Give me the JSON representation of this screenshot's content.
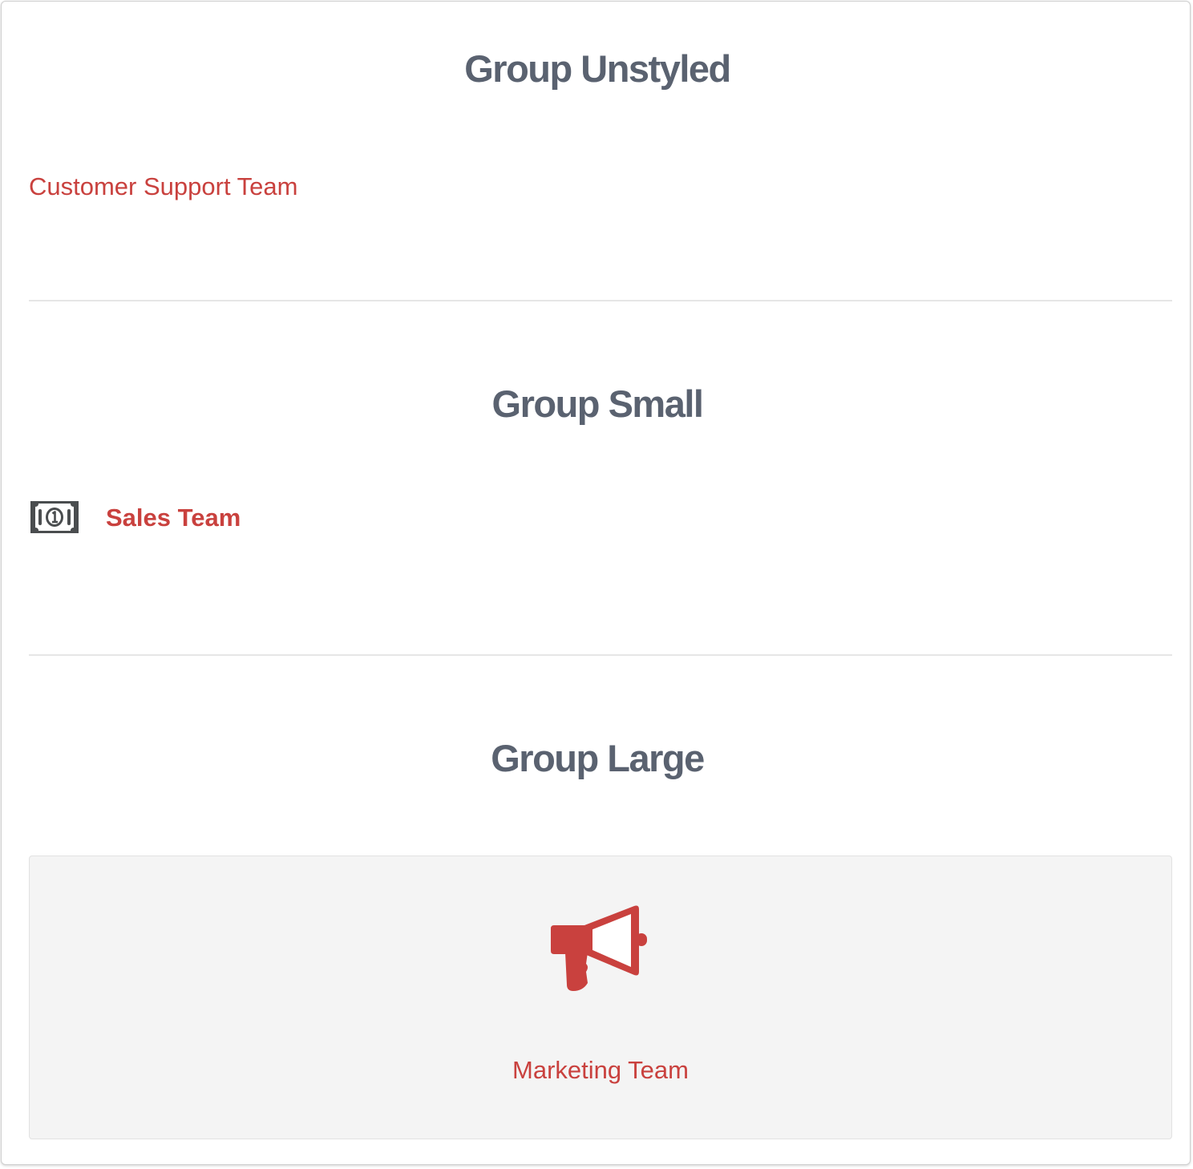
{
  "groups": {
    "unstyled": {
      "heading": "Group Unstyled",
      "item_label": "Customer Support Team"
    },
    "small": {
      "heading": "Group Small",
      "item_label": "Sales Team",
      "icon": "money-bill-icon"
    },
    "large": {
      "heading": "Group Large",
      "item_label": "Marketing Team",
      "icon": "megaphone-icon"
    }
  },
  "colors": {
    "heading": "#5a6270",
    "link": "#c9413e",
    "icon_dark": "#4a4d4f",
    "large_box_bg": "#f4f4f4",
    "divider": "#e6e6e6"
  }
}
